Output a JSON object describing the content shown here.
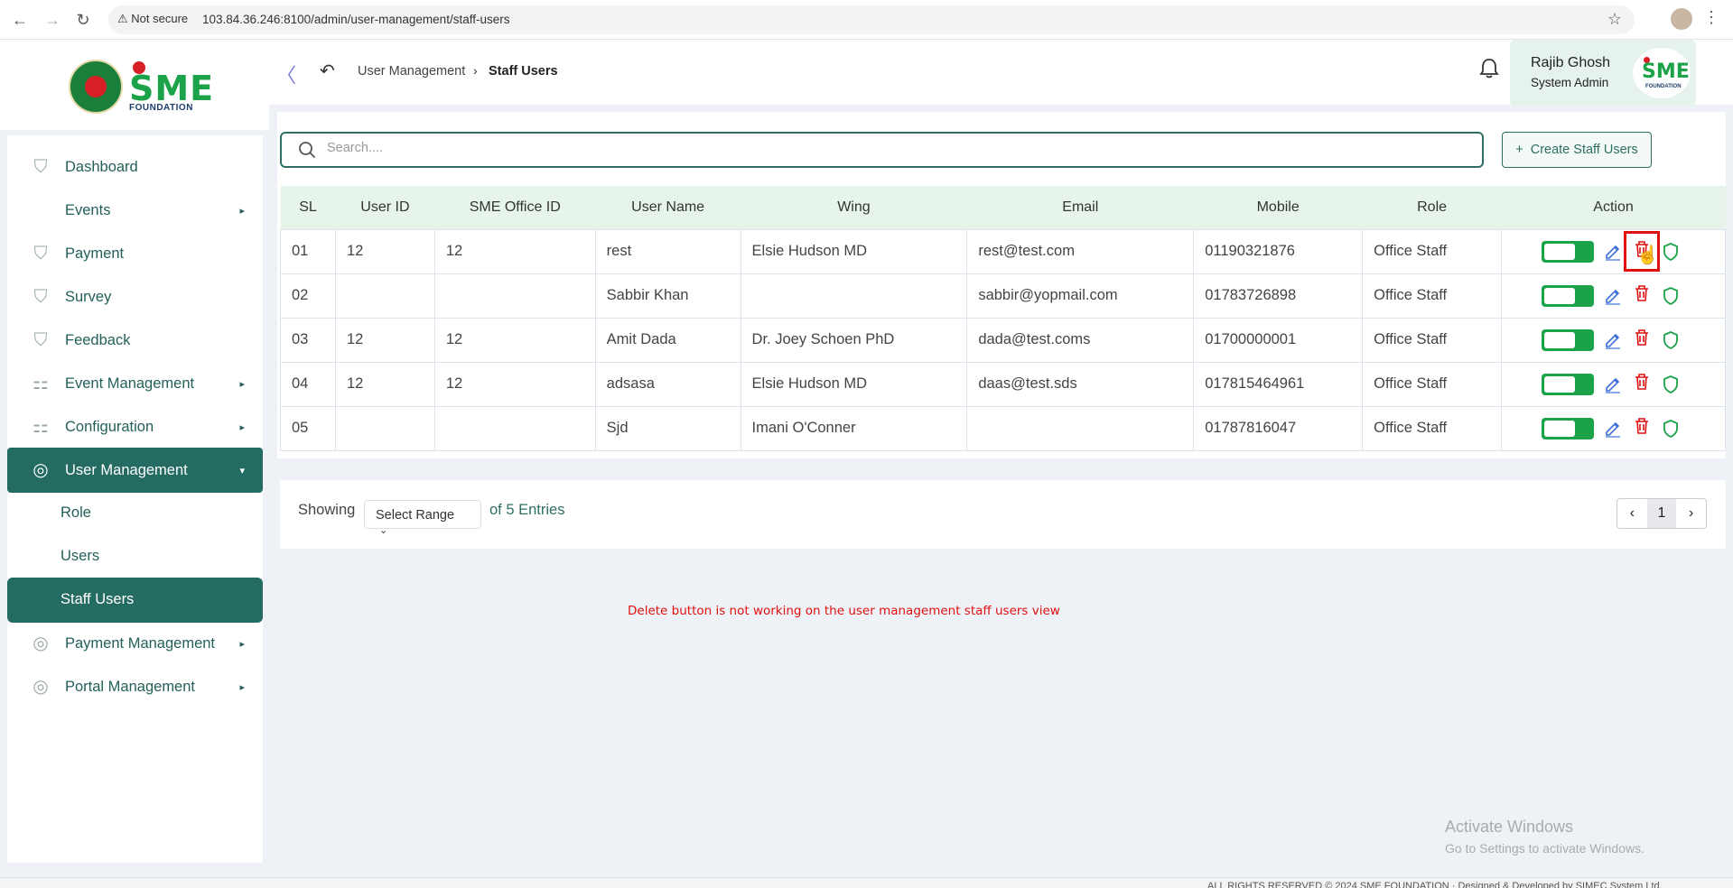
{
  "browser": {
    "security": "Not secure",
    "url": "103.84.36.246:8100/admin/user-management/staff-users"
  },
  "logo": {
    "brand": "SME",
    "sub": "FOUNDATION"
  },
  "sidebar": {
    "items": [
      {
        "label": "Dashboard"
      },
      {
        "label": "Events"
      },
      {
        "label": "Payment"
      },
      {
        "label": "Survey"
      },
      {
        "label": "Feedback"
      },
      {
        "label": "Event Management"
      },
      {
        "label": "Configuration"
      },
      {
        "label": "User Management"
      },
      {
        "label": "Role"
      },
      {
        "label": "Users"
      },
      {
        "label": "Staff Users"
      },
      {
        "label": "Payment Management"
      },
      {
        "label": "Portal Management"
      }
    ]
  },
  "header": {
    "breadcrumb_parent": "User Management",
    "breadcrumb_current": "Staff Users",
    "user_name": "Rajib Ghosh",
    "user_role": "System Admin"
  },
  "toolbar": {
    "search_placeholder": "Search....",
    "create_label": "Create Staff Users"
  },
  "table": {
    "columns": [
      "SL",
      "User ID",
      "SME Office ID",
      "User Name",
      "Wing",
      "Email",
      "Mobile",
      "Role",
      "Action"
    ],
    "rows": [
      {
        "sl": "01",
        "user_id": "12",
        "office_id": "12",
        "name": "rest",
        "wing": "Elsie Hudson MD",
        "email": "rest@test.com",
        "mobile": "01190321876",
        "role": "Office Staff"
      },
      {
        "sl": "02",
        "user_id": "",
        "office_id": "",
        "name": "Sabbir Khan",
        "wing": "",
        "email": "sabbir@yopmail.com",
        "mobile": "01783726898",
        "role": "Office Staff"
      },
      {
        "sl": "03",
        "user_id": "12",
        "office_id": "12",
        "name": "Amit Dada",
        "wing": "Dr. Joey Schoen PhD",
        "email": "dada@test.coms",
        "mobile": "01700000001",
        "role": "Office Staff"
      },
      {
        "sl": "04",
        "user_id": "12",
        "office_id": "12",
        "name": "adsasa",
        "wing": "Elsie Hudson MD",
        "email": "daas@test.sds",
        "mobile": "017815464961",
        "role": "Office Staff"
      },
      {
        "sl": "05",
        "user_id": "",
        "office_id": "",
        "name": "Sjd",
        "wing": "Imani O'Conner",
        "email": "",
        "mobile": "01787816047",
        "role": "Office Staff"
      }
    ]
  },
  "pagination": {
    "showing_label": "Showing",
    "range_placeholder": "Select Range",
    "entries_label": "of 5 Entries",
    "current_page": "1"
  },
  "annotation": "Delete button is not working on the user management staff users view",
  "watermark": {
    "line1": "Activate Windows",
    "line2": "Go to Settings to activate Windows."
  },
  "footer": "ALL RIGHTS RESERVED © 2024 SME FOUNDATION · Designed & Developed by SIMEC System Ltd.",
  "colors": {
    "primary": "#246b61",
    "accent_green": "#1ca34a",
    "danger": "#e01010",
    "edit_blue": "#3b6fd8"
  }
}
